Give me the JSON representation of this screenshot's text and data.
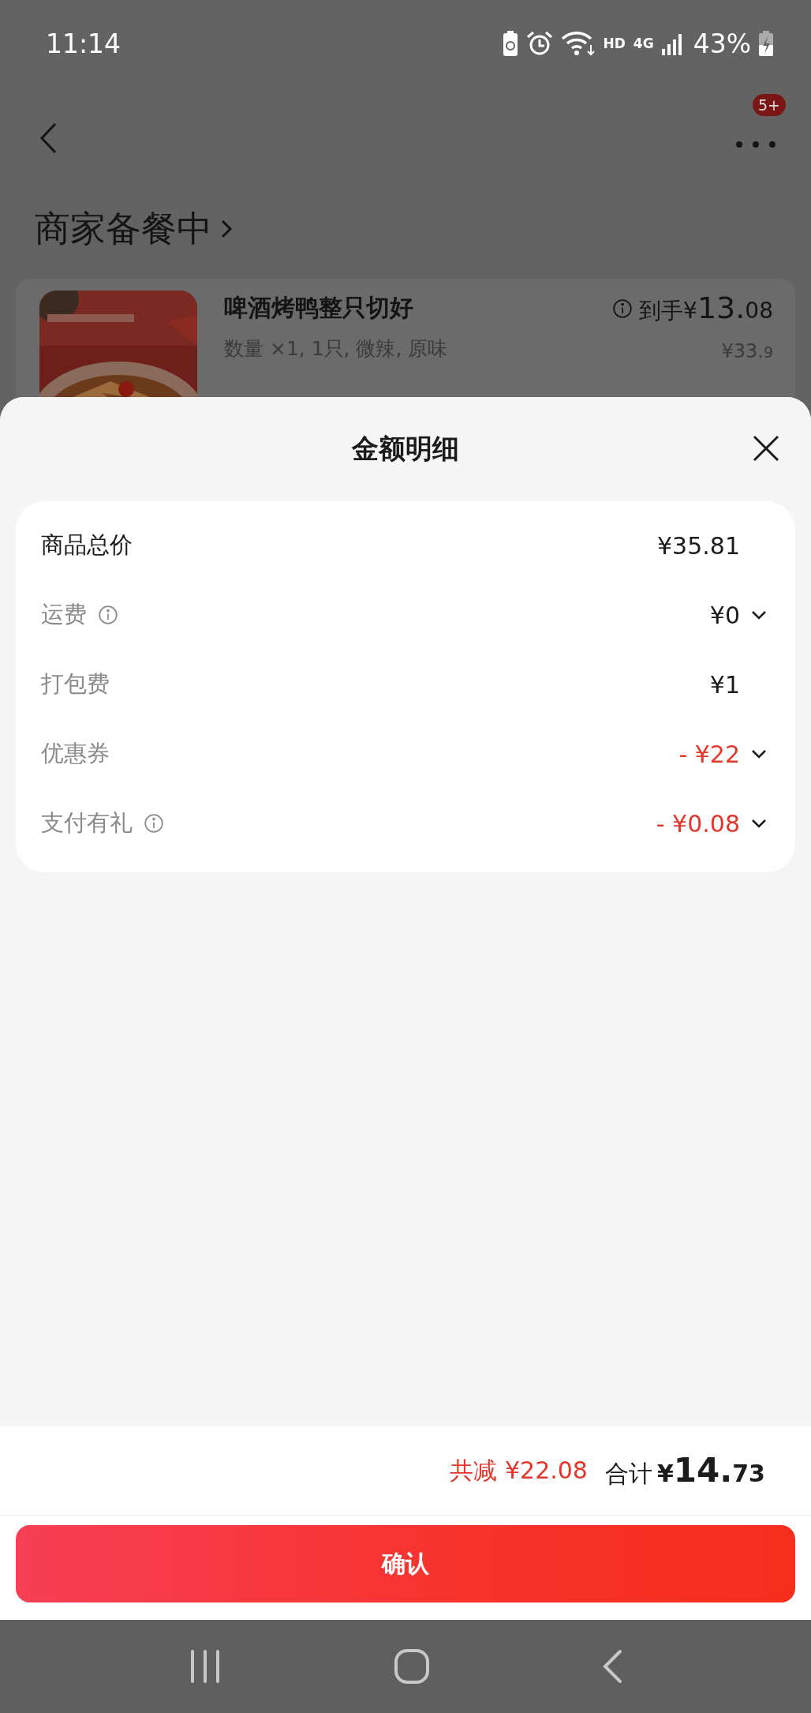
{
  "status_bar": {
    "time": "11:14",
    "wifi_label": "HD",
    "network": "4G",
    "battery": "43%"
  },
  "header": {
    "badge": "5+"
  },
  "order_status": {
    "title": "商家备餐中"
  },
  "product": {
    "name": "啤酒烤鸭整只切好",
    "specs": "数量 ×1, 1只, 微辣, 原味",
    "price": "到手¥13.08",
    "original_price": "¥33.9"
  },
  "sheet": {
    "title": "金额明细",
    "rows": [
      {
        "kind": "subtotal",
        "label": "商品总价",
        "value": "¥35.81",
        "info": false,
        "expandable": false
      },
      {
        "kind": "fee",
        "label": "运费",
        "value": "¥0",
        "info": true,
        "expandable": true
      },
      {
        "kind": "fee",
        "label": "打包费",
        "value": "¥1",
        "info": false,
        "expandable": false
      },
      {
        "kind": "discount",
        "label": "优惠券",
        "value": "- ¥22",
        "info": false,
        "expandable": true
      },
      {
        "kind": "discount",
        "label": "支付有礼",
        "value": "- ¥0.08",
        "info": true,
        "expandable": true
      }
    ]
  },
  "footer": {
    "savings": "共减 ¥22.08",
    "total_label": "合计",
    "total": "¥14.73",
    "confirm": "确认"
  }
}
